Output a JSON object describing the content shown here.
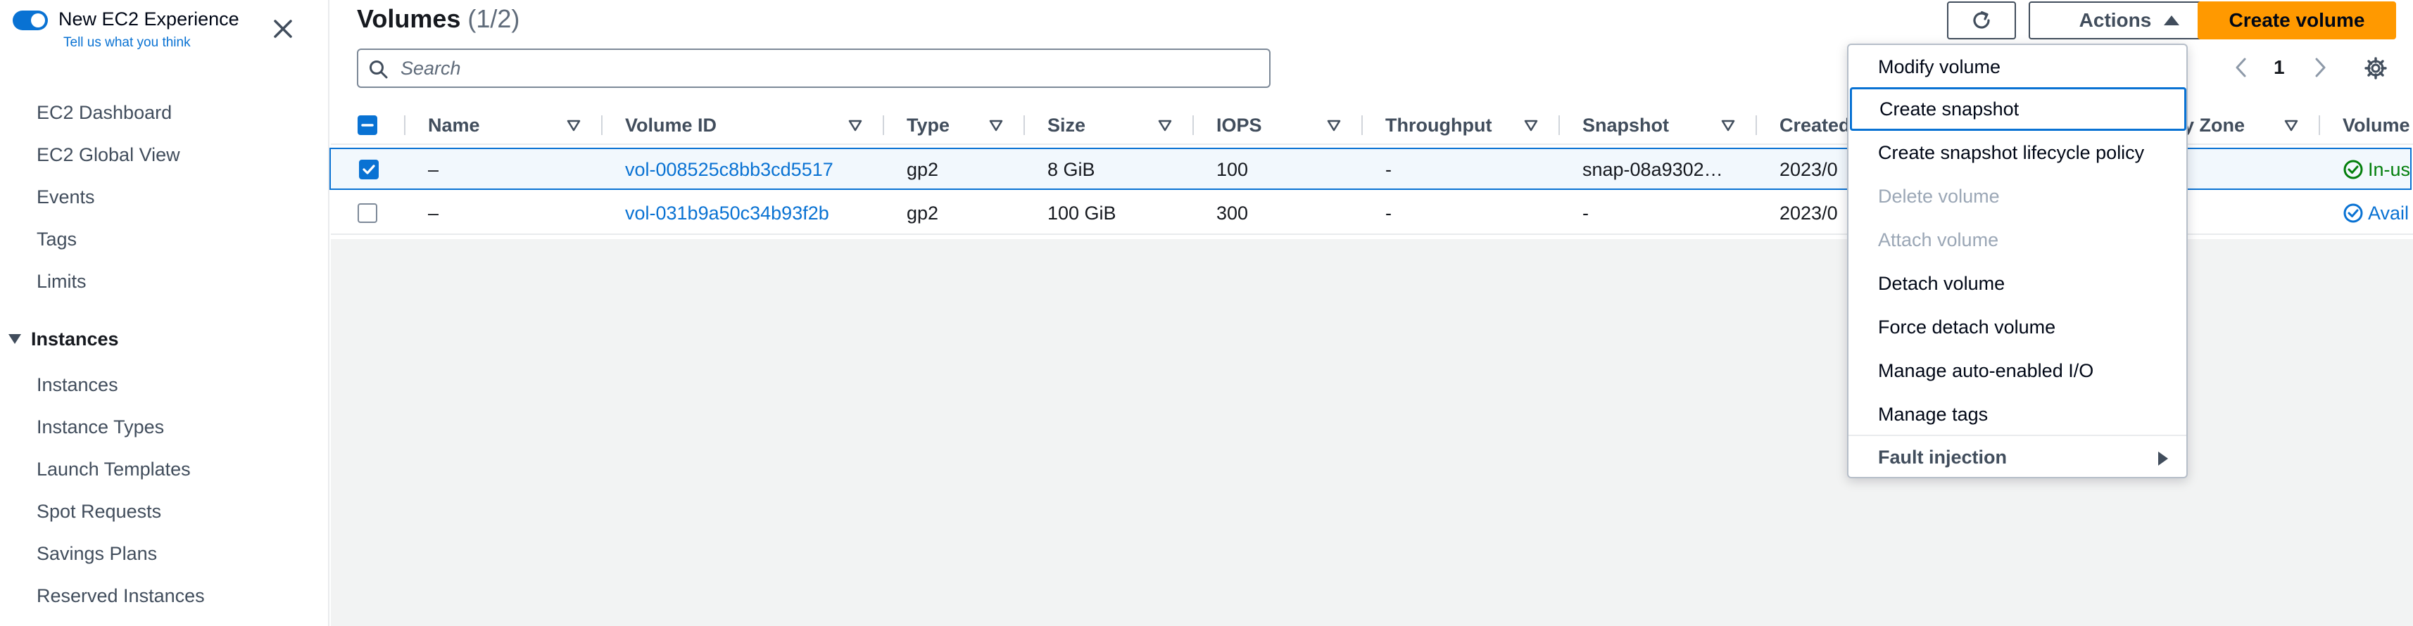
{
  "sidebar": {
    "experience_title": "New EC2 Experience",
    "experience_link": "Tell us what you think",
    "items": [
      "EC2 Dashboard",
      "EC2 Global View",
      "Events",
      "Tags",
      "Limits"
    ],
    "section_title": "Instances",
    "section_items": [
      "Instances",
      "Instance Types",
      "Launch Templates",
      "Spot Requests",
      "Savings Plans",
      "Reserved Instances"
    ]
  },
  "header": {
    "title": "Volumes",
    "count": "(1/2)",
    "actions_label": "Actions",
    "create_label": "Create volume"
  },
  "search": {
    "placeholder": "Search"
  },
  "pagination": {
    "page": "1"
  },
  "table": {
    "columns": [
      "Name",
      "Volume ID",
      "Type",
      "Size",
      "IOPS",
      "Throughput",
      "Snapshot",
      "Created",
      "y Zone",
      "Volume"
    ],
    "rows": [
      {
        "selected": true,
        "name": "–",
        "volume_id": "vol-008525c8bb3cd5517",
        "type": "gp2",
        "size": "8 GiB",
        "iops": "100",
        "throughput": "-",
        "snapshot": "snap-08a9302…",
        "created": "2023/0",
        "state": "In-us"
      },
      {
        "selected": false,
        "name": "–",
        "volume_id": "vol-031b9a50c34b93f2b",
        "type": "gp2",
        "size": "100 GiB",
        "iops": "300",
        "throughput": "-",
        "snapshot": "-",
        "created": "2023/0",
        "state": "Avail"
      }
    ]
  },
  "actions_menu": {
    "items": [
      {
        "label": "Modify volume",
        "state": "enabled"
      },
      {
        "label": "Create snapshot",
        "state": "focused"
      },
      {
        "label": "Create snapshot lifecycle policy",
        "state": "enabled"
      },
      {
        "label": "Delete volume",
        "state": "disabled"
      },
      {
        "label": "Attach volume",
        "state": "disabled"
      },
      {
        "label": "Detach volume",
        "state": "enabled"
      },
      {
        "label": "Force detach volume",
        "state": "enabled"
      },
      {
        "label": "Manage auto-enabled I/O",
        "state": "enabled"
      },
      {
        "label": "Manage tags",
        "state": "enabled"
      },
      {
        "label": "Fault injection",
        "state": "submenu"
      }
    ]
  },
  "icons": {
    "close": "close-icon",
    "refresh": "refresh-icon",
    "search": "search-icon",
    "settings": "gear-icon",
    "success": "check-circle-icon",
    "available": "check-circle-outline-icon"
  },
  "colors": {
    "link": "#0972d3",
    "primary_button": "#ff9900",
    "success": "#037f0c",
    "disabled": "#9ba7b6"
  }
}
